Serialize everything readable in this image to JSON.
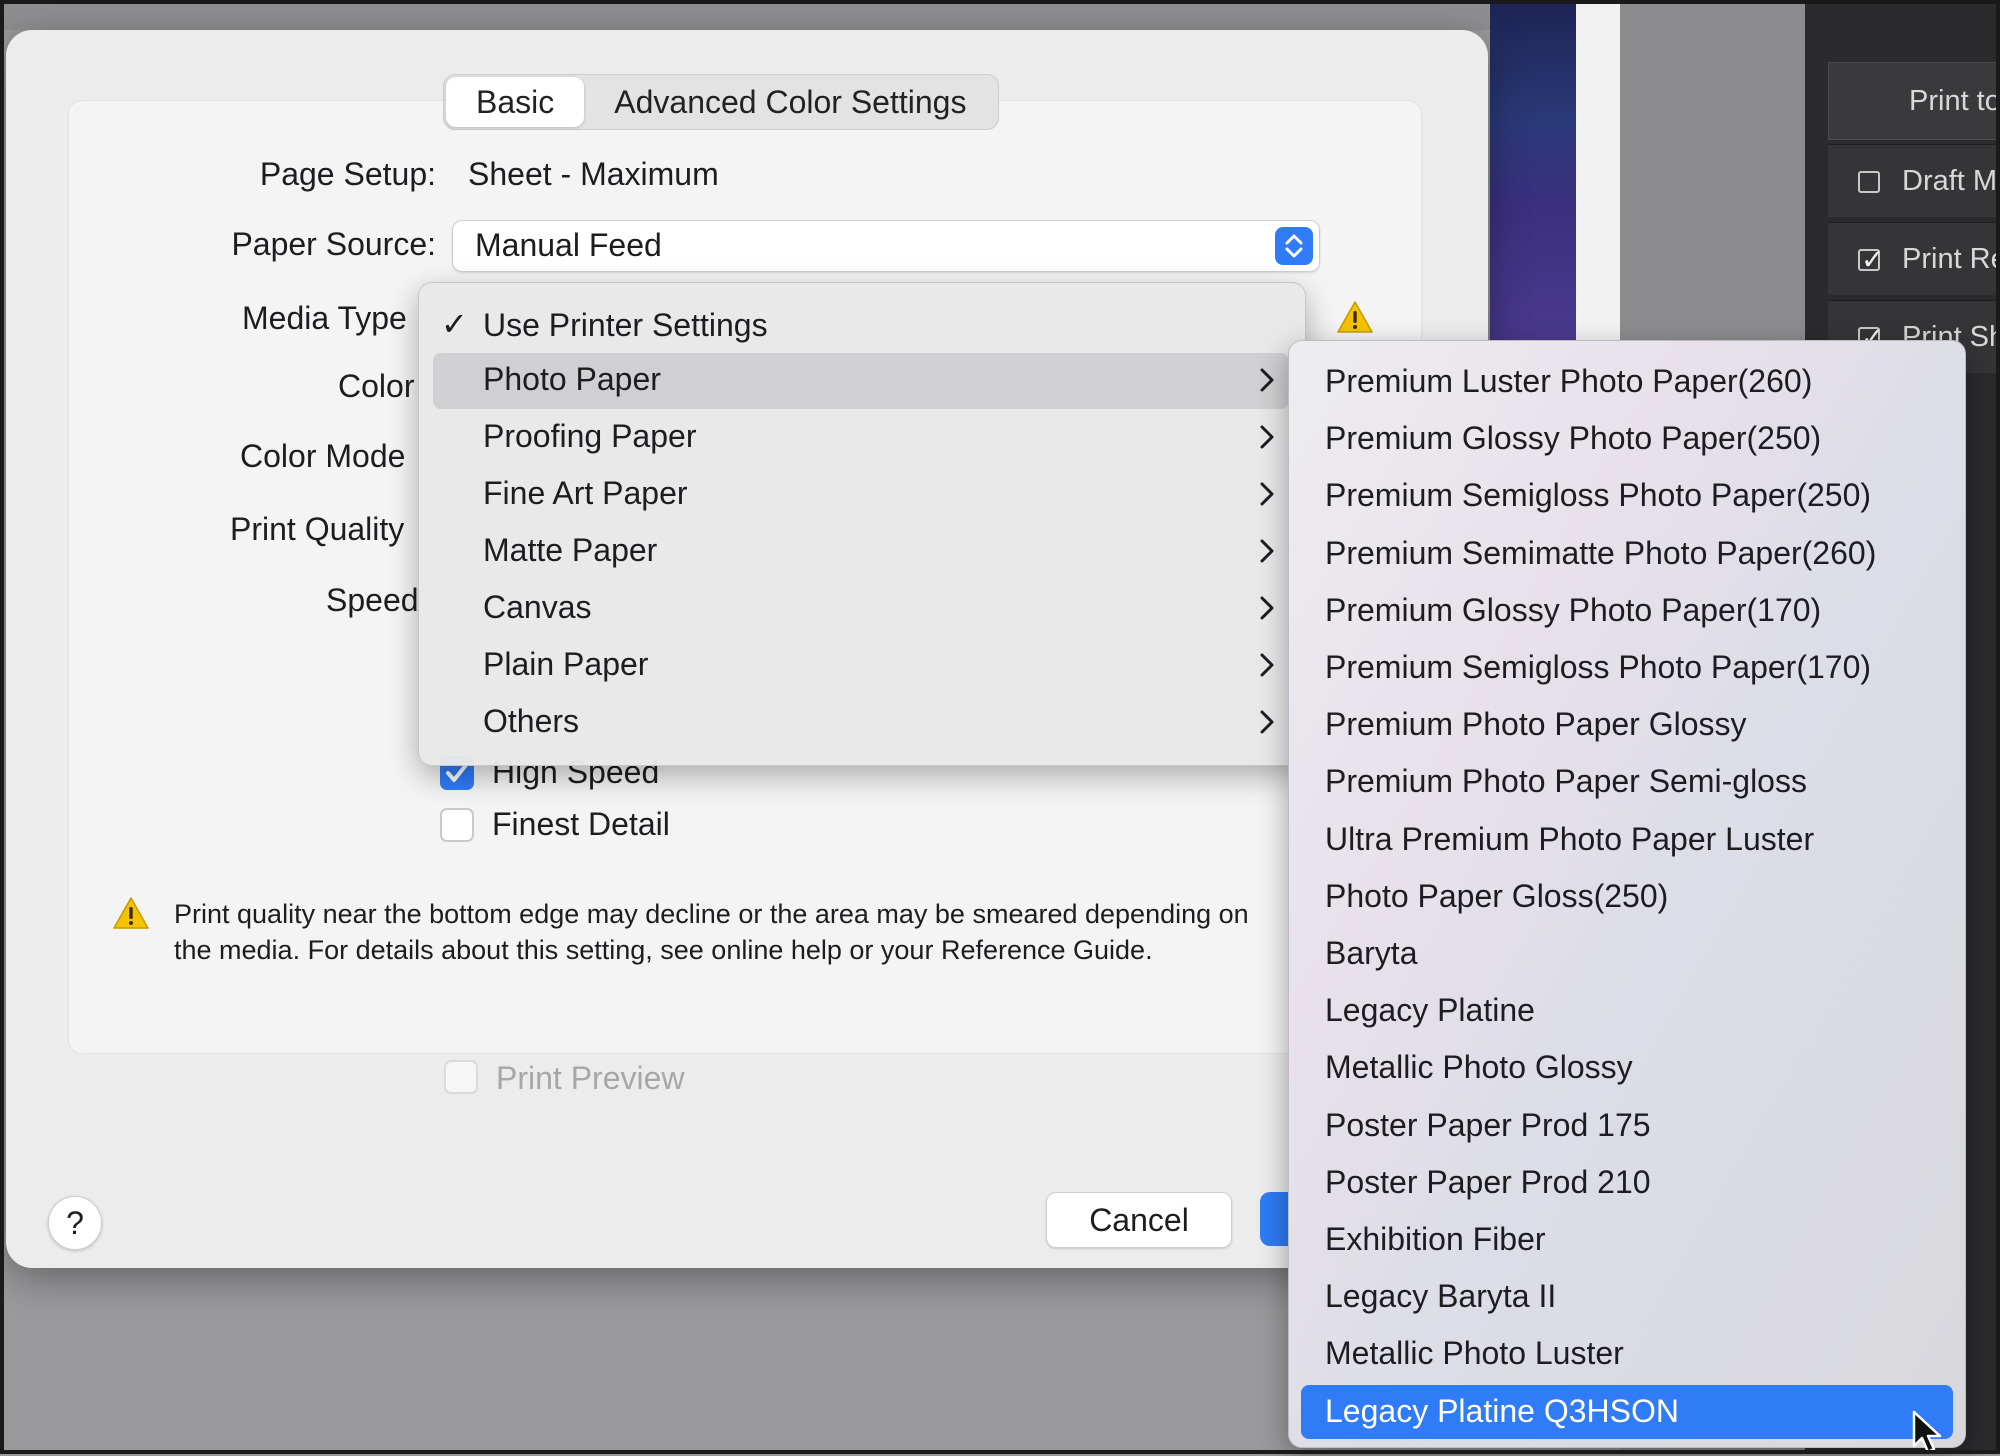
{
  "dialog": {
    "tabs": [
      {
        "label": "Basic",
        "active": true
      },
      {
        "label": "Advanced Color Settings",
        "active": false
      }
    ],
    "page_setup": {
      "label": "Page Setup:",
      "value": "Sheet - Maximum"
    },
    "paper_source": {
      "label": "Paper Source:",
      "value": "Manual Feed"
    },
    "labels": {
      "media_type": "Media Type",
      "color": "Color",
      "color_mode": "Color Mode",
      "print_quality": "Print Quality",
      "speed": "Speed"
    },
    "high_speed": {
      "label": "High Speed",
      "checked": true
    },
    "finest_detail": {
      "label": "Finest Detail",
      "checked": false
    },
    "warning": "Print quality near the bottom edge may decline or the area may be smeared depending on the media. For details about this setting, see online help or your Reference Guide.",
    "print_preview": {
      "label": "Print Preview",
      "checked": false,
      "disabled": true
    },
    "help_label": "?",
    "cancel_label": "Cancel"
  },
  "media_menu": {
    "items": [
      {
        "label": "Use Printer Settings",
        "checked": true,
        "submenu": false
      },
      {
        "label": "Photo Paper",
        "checked": false,
        "submenu": true,
        "highlighted": true
      },
      {
        "label": "Proofing Paper",
        "checked": false,
        "submenu": true
      },
      {
        "label": "Fine Art Paper",
        "checked": false,
        "submenu": true
      },
      {
        "label": "Matte Paper",
        "checked": false,
        "submenu": true
      },
      {
        "label": "Canvas",
        "checked": false,
        "submenu": true
      },
      {
        "label": "Plain Paper",
        "checked": false,
        "submenu": true
      },
      {
        "label": "Others",
        "checked": false,
        "submenu": true
      }
    ]
  },
  "photo_paper_submenu": {
    "items": [
      "Premium Luster Photo Paper(260)",
      "Premium Glossy Photo Paper(250)",
      "Premium Semigloss Photo Paper(250)",
      "Premium Semimatte Photo Paper(260)",
      "Premium Glossy Photo Paper(170)",
      "Premium Semigloss Photo Paper(170)",
      "Premium Photo Paper Glossy",
      "Premium Photo Paper Semi-gloss",
      "Ultra Premium Photo Paper Luster",
      "Photo Paper Gloss(250)",
      "Baryta",
      "Legacy Platine",
      "Metallic Photo Glossy",
      "Poster Paper Prod 175",
      "Poster Paper Prod 210",
      "Exhibition Fiber",
      "Legacy Baryta II",
      "Metallic Photo Luster",
      "Legacy Platine Q3HSON"
    ],
    "selected_index": 18
  },
  "background_panel": {
    "print_to": "Print to",
    "draft_mode": "Draft Mo",
    "print_res": "Print Re",
    "print_sh": "Print Sh"
  },
  "colors": {
    "accent": "#2f7cf6",
    "warning": "#f4c400"
  }
}
